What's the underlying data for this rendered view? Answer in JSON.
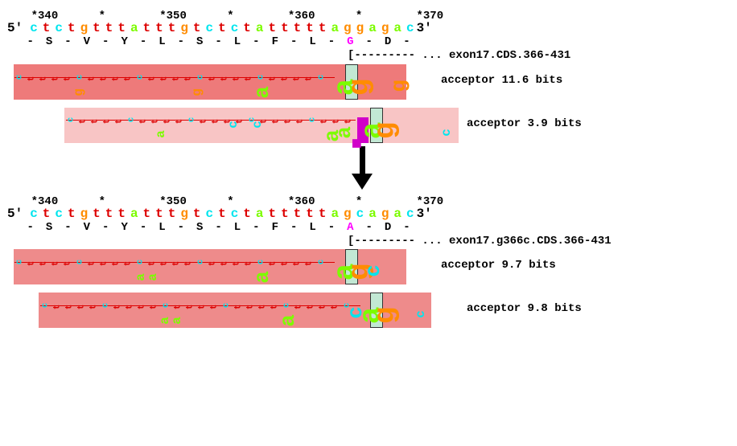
{
  "ruler_positions": [
    340,
    350,
    360,
    370
  ],
  "sequence_top": {
    "five": "5'",
    "three": "3'",
    "bases": [
      "c",
      "t",
      "c",
      "t",
      "g",
      "t",
      "t",
      "t",
      "a",
      "t",
      "t",
      "t",
      "g",
      "t",
      "c",
      "t",
      "c",
      "t",
      "a",
      "t",
      "t",
      "t",
      "t",
      "t",
      "a",
      "g",
      "g",
      "a",
      "g",
      "a",
      "c"
    ]
  },
  "amino_top": [
    "-",
    "S",
    "-",
    "V",
    "-",
    "Y",
    "-",
    "L",
    "-",
    "S",
    "-",
    "L",
    "-",
    "F",
    "-",
    "L",
    "-",
    "G",
    "-",
    "D",
    "-"
  ],
  "amino_top_hl_index": 17,
  "annot_top": "[--------- ... exon17.CDS.366-431",
  "acceptor1": {
    "label": "acceptor 11.6 bits"
  },
  "acceptor2": {
    "label": "acceptor  3.9 bits"
  },
  "sequence_bottom": {
    "five": "5'",
    "three": "3'",
    "bases": [
      "c",
      "t",
      "c",
      "t",
      "g",
      "t",
      "t",
      "t",
      "a",
      "t",
      "t",
      "t",
      "g",
      "t",
      "c",
      "t",
      "c",
      "t",
      "a",
      "t",
      "t",
      "t",
      "t",
      "t",
      "a",
      "g",
      "c",
      "a",
      "g",
      "a",
      "c"
    ]
  },
  "amino_bottom": [
    "-",
    "S",
    "-",
    "V",
    "-",
    "Y",
    "-",
    "L",
    "-",
    "S",
    "-",
    "L",
    "-",
    "F",
    "-",
    "L",
    "-",
    "A",
    "-",
    "D",
    "-"
  ],
  "amino_bottom_hl_index": 17,
  "annot_bottom": "[--------- ... exon17.g366c.CDS.366-431",
  "acceptor3": {
    "label": "acceptor  9.7 bits"
  },
  "acceptor4": {
    "label": "acceptor  9.8 bits"
  },
  "logo_letters": {
    "t": "t",
    "a": "a",
    "g": "g",
    "c": "c"
  }
}
